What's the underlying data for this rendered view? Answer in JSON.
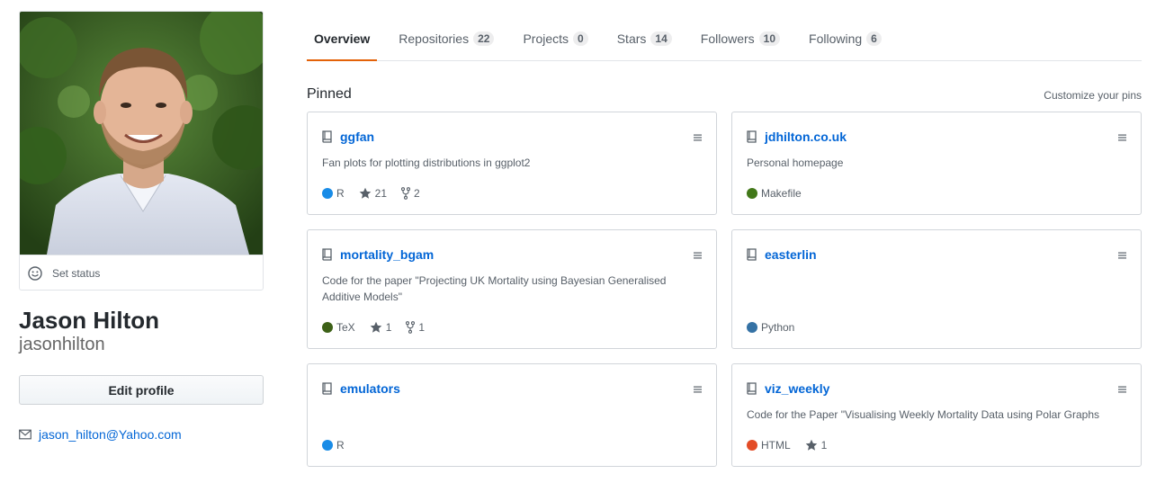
{
  "profile": {
    "full_name": "Jason Hilton",
    "username": "jasonhilton",
    "set_status_label": "Set status",
    "edit_profile_label": "Edit profile",
    "email": "jason_hilton@Yahoo.com"
  },
  "tabs": [
    {
      "label": "Overview",
      "count": null,
      "selected": true
    },
    {
      "label": "Repositories",
      "count": "22",
      "selected": false
    },
    {
      "label": "Projects",
      "count": "0",
      "selected": false
    },
    {
      "label": "Stars",
      "count": "14",
      "selected": false
    },
    {
      "label": "Followers",
      "count": "10",
      "selected": false
    },
    {
      "label": "Following",
      "count": "6",
      "selected": false
    }
  ],
  "pinned": {
    "title": "Pinned",
    "customize_label": "Customize your pins",
    "repos": [
      {
        "name": "ggfan",
        "description": "Fan plots for plotting distributions in ggplot2",
        "language": "R",
        "language_color": "#198ce7",
        "stars": "21",
        "forks": "2"
      },
      {
        "name": "jdhilton.co.uk",
        "description": "Personal homepage",
        "language": "Makefile",
        "language_color": "#427819",
        "stars": "",
        "forks": ""
      },
      {
        "name": "mortality_bgam",
        "description": "Code for the paper \"Projecting UK Mortality using Bayesian Generalised Additive Models\"",
        "language": "TeX",
        "language_color": "#3D6117",
        "stars": "1",
        "forks": "1"
      },
      {
        "name": "easterlin",
        "description": "",
        "language": "Python",
        "language_color": "#3572A5",
        "stars": "",
        "forks": ""
      },
      {
        "name": "emulators",
        "description": "",
        "language": "R",
        "language_color": "#198ce7",
        "stars": "",
        "forks": ""
      },
      {
        "name": "viz_weekly",
        "description": "Code for the Paper \"Visualising Weekly Mortality Data using Polar Graphs",
        "language": "HTML",
        "language_color": "#e34c26",
        "stars": "1",
        "forks": ""
      }
    ]
  },
  "colors": {
    "link": "#0366d6",
    "selected_tab_underline": "#e36209",
    "muted_text": "#586069"
  },
  "icons": {
    "status": "smiley-icon",
    "email": "mail-icon",
    "repo": "repo-icon",
    "star": "star-icon",
    "fork": "fork-icon",
    "drag": "grabber-icon"
  }
}
